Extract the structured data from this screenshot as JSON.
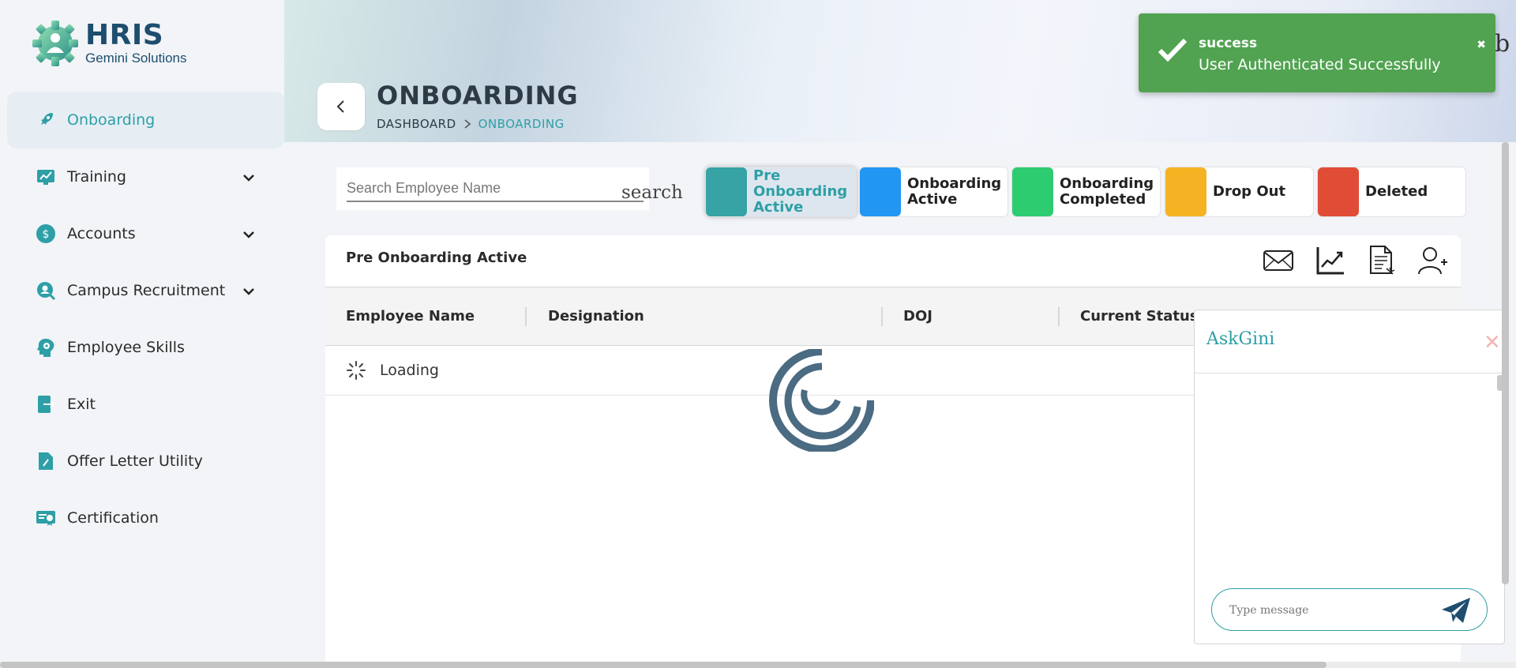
{
  "brand": {
    "title": "HRIS",
    "subtitle": "Gemini Solutions"
  },
  "sidebar": {
    "items": [
      {
        "label": "Onboarding",
        "icon": "rocket-icon",
        "active": true
      },
      {
        "label": "Training",
        "icon": "chart-board-icon",
        "expandable": true
      },
      {
        "label": "Accounts",
        "icon": "dollar-icon",
        "expandable": true
      },
      {
        "label": "Campus Recruitment",
        "icon": "user-search-icon",
        "expandable": true
      },
      {
        "label": "Employee Skills",
        "icon": "head-gear-icon"
      },
      {
        "label": "Exit",
        "icon": "exit-door-icon"
      },
      {
        "label": "Offer Letter Utility",
        "icon": "document-pen-icon"
      },
      {
        "label": "Certification",
        "icon": "certificate-icon"
      }
    ]
  },
  "header": {
    "title": "ONBOARDING",
    "breadcrumb": {
      "root": "DASHBOARD",
      "current": "ONBOARDING"
    }
  },
  "toast": {
    "title": "success",
    "message": "User Authenticated Successfully",
    "close": "✖"
  },
  "edge_text": "b",
  "search": {
    "placeholder": "Search Employee Name",
    "value": "",
    "button": "search"
  },
  "status_tabs": [
    {
      "label": "Pre Onboarding Active",
      "color": "#37a3a5",
      "selected": true
    },
    {
      "label": "Onboarding Active",
      "color": "#2196f3"
    },
    {
      "label": "Onboarding Completed",
      "color": "#2ecc71"
    },
    {
      "label": "Drop Out",
      "color": "#f5b323"
    },
    {
      "label": "Deleted",
      "color": "#e14c37"
    }
  ],
  "table": {
    "title": "Pre Onboarding Active",
    "toolbar": [
      "mail-icon",
      "trend-chart-icon",
      "report-document-icon",
      "add-user-icon"
    ],
    "columns": [
      "Employee Name",
      "Designation",
      "DOJ",
      "Current Status"
    ],
    "loading_text": "Loading"
  },
  "askgini": {
    "title": "AskGini",
    "placeholder": "Type message",
    "close": "✕"
  },
  "colors": {
    "accent": "#2e9fa6",
    "brand": "#1d4e6e",
    "toast": "#51a351",
    "spinner": "#4a6b82"
  }
}
